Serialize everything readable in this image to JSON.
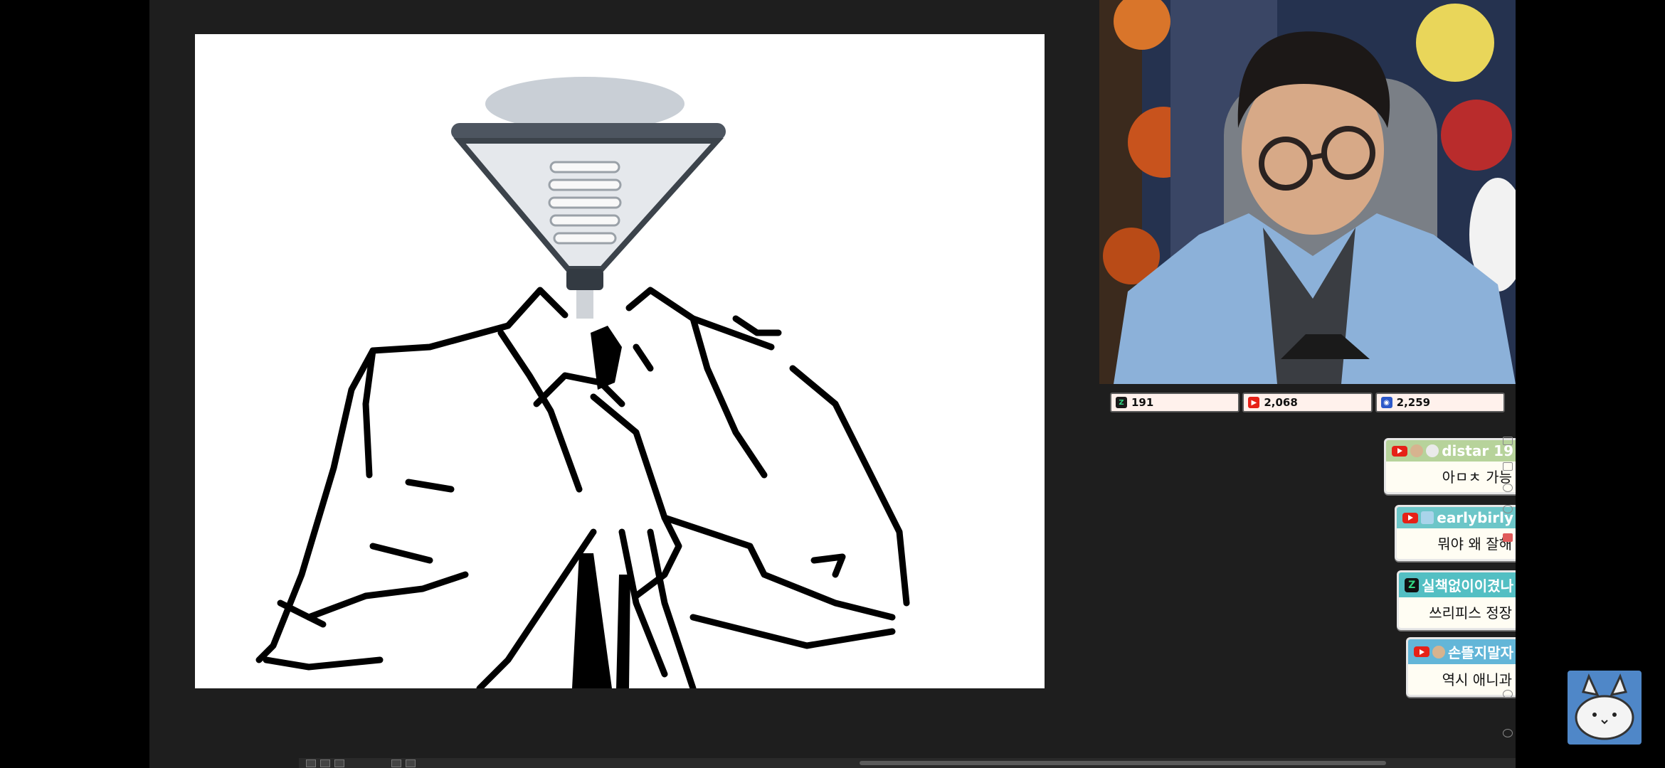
{
  "stats": [
    {
      "icon": "chzzk-icon",
      "color": "#1a1a1a",
      "value": "191"
    },
    {
      "icon": "youtube-icon",
      "color": "#e62117",
      "value": "2,068"
    },
    {
      "icon": "afreeca-icon",
      "color": "#2d59c9",
      "value": "2,259"
    }
  ],
  "chat": [
    {
      "platform": "youtube",
      "name": "distar 19",
      "text": "아ㅁㅊ 가능",
      "name_color": "#b7d39b"
    },
    {
      "platform": "youtube",
      "name": "earlybirly",
      "text": "뭐야 왜 잘해",
      "name_color": "#6cc6c8"
    },
    {
      "platform": "chzzk",
      "name": "실책없이이겼나",
      "text": "쓰리피스 정장",
      "name_color": "#53bfc3"
    },
    {
      "platform": "youtube",
      "name": "손뜰지말자",
      "text": "역시 애니과",
      "name_color": "#63b6d8"
    }
  ],
  "colors": {
    "accent": "#6cc6c8",
    "youtube": "#e62117",
    "canvas_bg": "#ffffff",
    "app_bg": "#1e1e1e"
  }
}
